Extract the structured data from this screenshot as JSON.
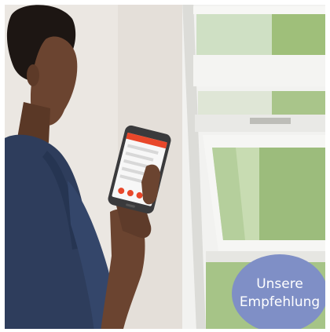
{
  "badge": {
    "line1": "Unsere",
    "line2": "Empfehlung",
    "color": "#7f8fc6"
  },
  "photo": {
    "subject": "woman-holding-smartphone-next-to-roof-window",
    "palette": {
      "wall": "#ebe7e2",
      "window_frame": "#f4f4f2",
      "foliage": "#9fbf7a",
      "shirt": "#2e3d5c",
      "skin": "#6b4430",
      "hair": "#1d1613",
      "app_accent": "#e8472a"
    }
  }
}
